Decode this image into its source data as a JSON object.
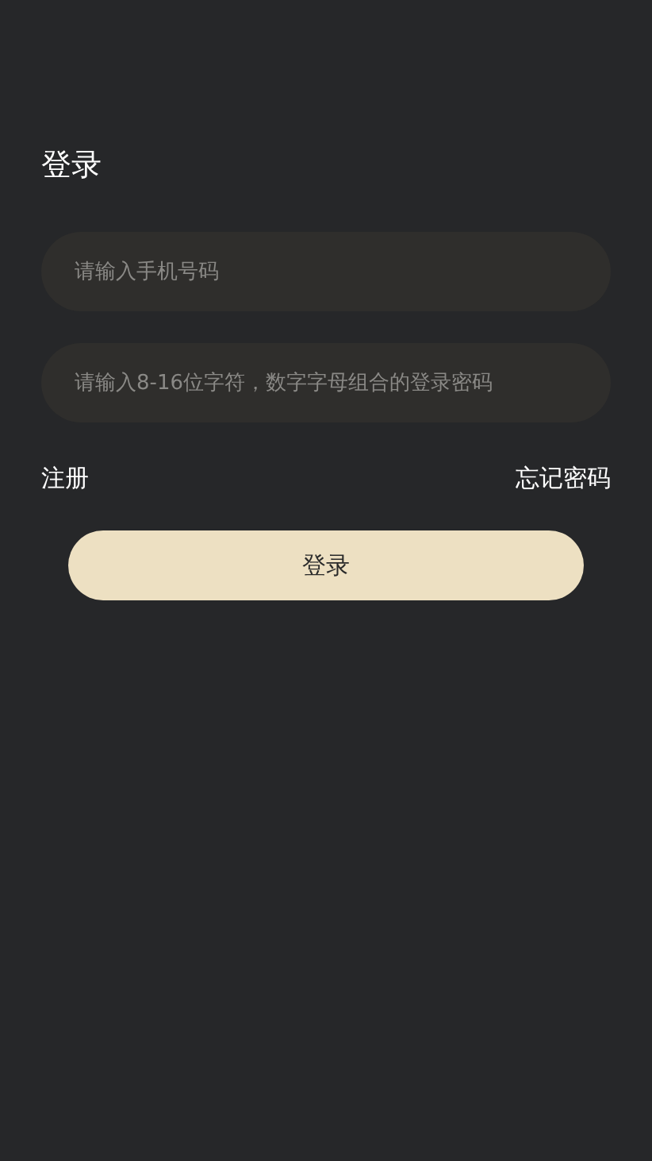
{
  "title": "登录",
  "fields": [
    {
      "placeholder": "请输入手机号码"
    },
    {
      "placeholder": "请输入8-16位字符，数字字母组合的登录密码"
    }
  ],
  "links": {
    "register": "注册",
    "forgot": "忘记密码"
  },
  "submit": "登录"
}
